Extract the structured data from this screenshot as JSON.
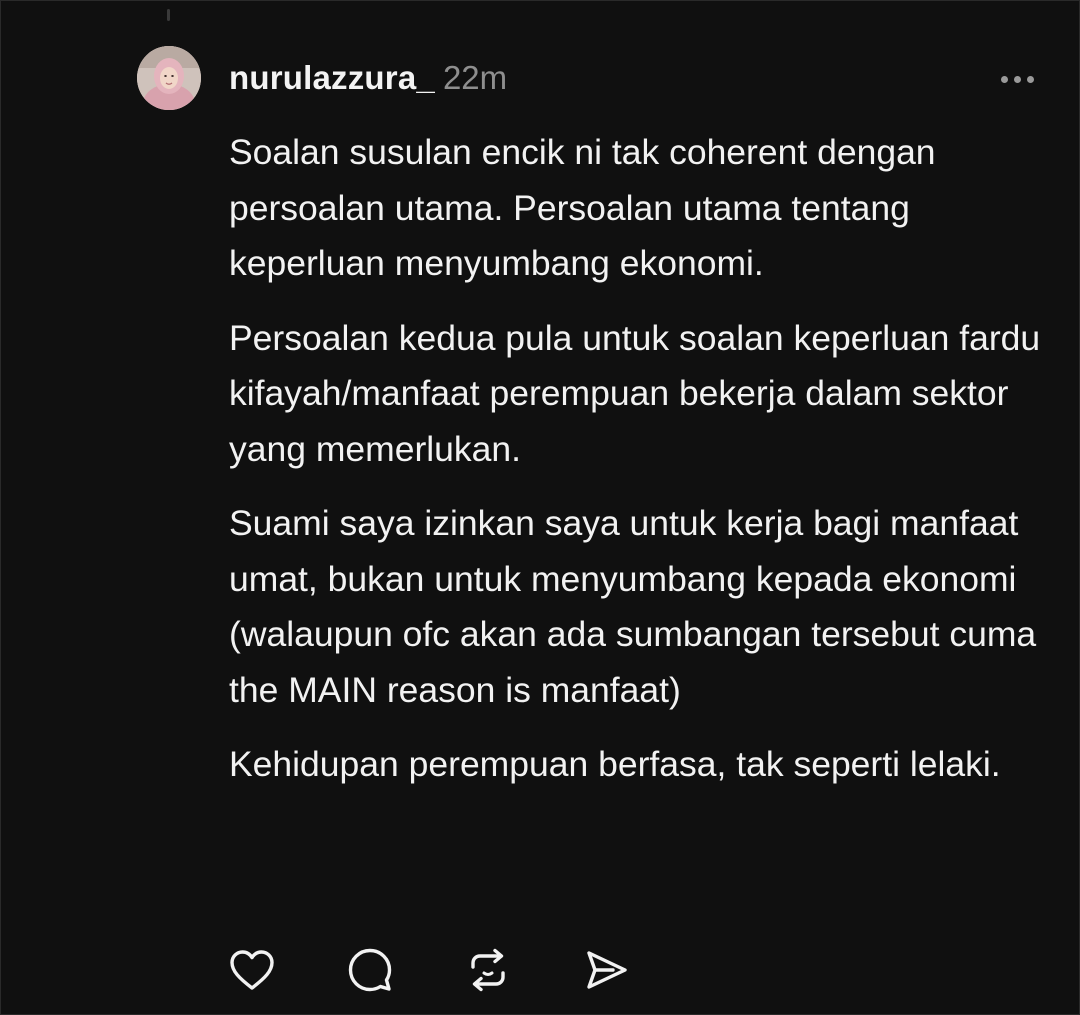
{
  "post": {
    "username": "nurulazzura_",
    "timestamp": "22m",
    "paragraphs": [
      "Soalan susulan encik ni tak coherent dengan persoalan utama. Persoalan utama tentang keperluan menyumbang ekonomi.",
      "Persoalan kedua pula untuk soalan keperluan fardu kifayah/manfaat perempuan bekerja dalam sektor yang memerlukan.",
      "Suami saya izinkan saya untuk kerja bagi manfaat umat, bukan untuk menyumbang kepada ekonomi (walaupun ofc akan ada sumbangan tersebut cuma the MAIN reason is manfaat)",
      "Kehidupan perempuan berfasa, tak seperti lelaki."
    ]
  },
  "actions": {
    "like_icon": "heart-icon",
    "reply_icon": "speech-bubble-icon",
    "repost_icon": "repost-icon",
    "share_icon": "send-icon"
  },
  "colors": {
    "background": "#101010",
    "text": "#f2f2f2",
    "muted": "#8e8e8e"
  }
}
